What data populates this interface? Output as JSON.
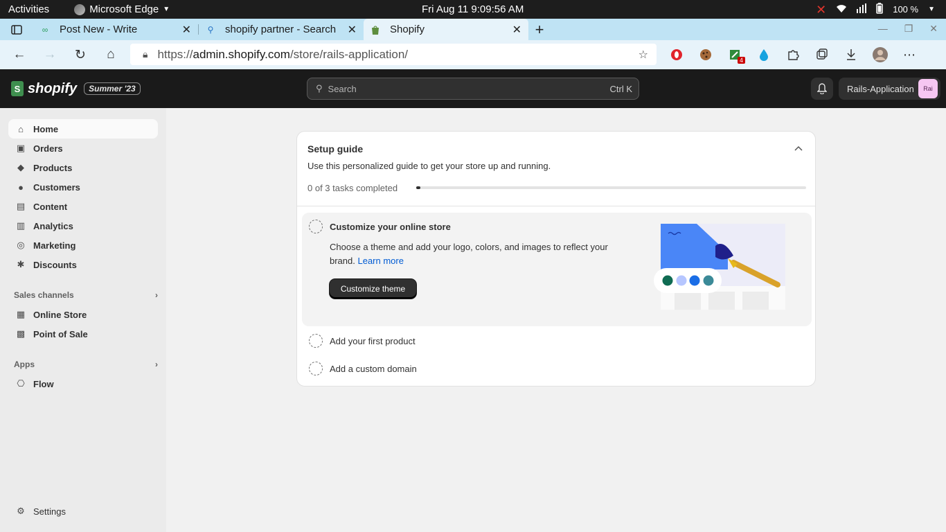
{
  "system_bar": {
    "activities": "Activities",
    "app_name": "Microsoft Edge",
    "clock": "Fri Aug 11   9:09:56 AM",
    "battery": "100 %"
  },
  "browser": {
    "tabs": [
      {
        "title": "Post New - Write",
        "active": false
      },
      {
        "title": "shopify partner - Search",
        "active": false
      },
      {
        "title": "Shopify",
        "active": true
      }
    ],
    "url_prefix": "https://",
    "url_host": "admin.shopify.com",
    "url_path": "/store/rails-application/",
    "extension_badge": "4"
  },
  "topbar": {
    "logo_text": "shopify",
    "edition": "Summer '23",
    "search_placeholder": "Search",
    "search_shortcut": "Ctrl K",
    "store_name": "Rails-Application",
    "avatar_initials": "Rai"
  },
  "sidebar": {
    "items": [
      {
        "label": "Home",
        "icon": "home-icon"
      },
      {
        "label": "Orders",
        "icon": "inbox-icon"
      },
      {
        "label": "Products",
        "icon": "tag-icon"
      },
      {
        "label": "Customers",
        "icon": "person-icon"
      },
      {
        "label": "Content",
        "icon": "image-icon"
      },
      {
        "label": "Analytics",
        "icon": "chart-icon"
      },
      {
        "label": "Marketing",
        "icon": "target-icon"
      },
      {
        "label": "Discounts",
        "icon": "discount-icon"
      }
    ],
    "sales_channels_header": "Sales channels",
    "sales_channels": [
      {
        "label": "Online Store",
        "icon": "store-icon"
      },
      {
        "label": "Point of Sale",
        "icon": "pos-icon"
      }
    ],
    "apps_header": "Apps",
    "apps": [
      {
        "label": "Flow",
        "icon": "flow-icon"
      }
    ],
    "settings_label": "Settings"
  },
  "setup_guide": {
    "title": "Setup guide",
    "subtitle": "Use this personalized guide to get your store up and running.",
    "progress_text": "0 of 3 tasks completed",
    "progress_fraction": 0.01,
    "tasks": [
      {
        "title": "Customize your online store",
        "description": "Choose a theme and add your logo, colors, and images to reflect your brand. ",
        "link": "Learn more",
        "button": "Customize theme"
      },
      {
        "title": "Add your first product"
      },
      {
        "title": "Add a custom domain"
      }
    ]
  },
  "colors": {
    "topbar_bg": "#1a1a1a",
    "sidebar_bg": "#ebebeb",
    "link": "#005bd3",
    "primary_button": "#303030"
  }
}
